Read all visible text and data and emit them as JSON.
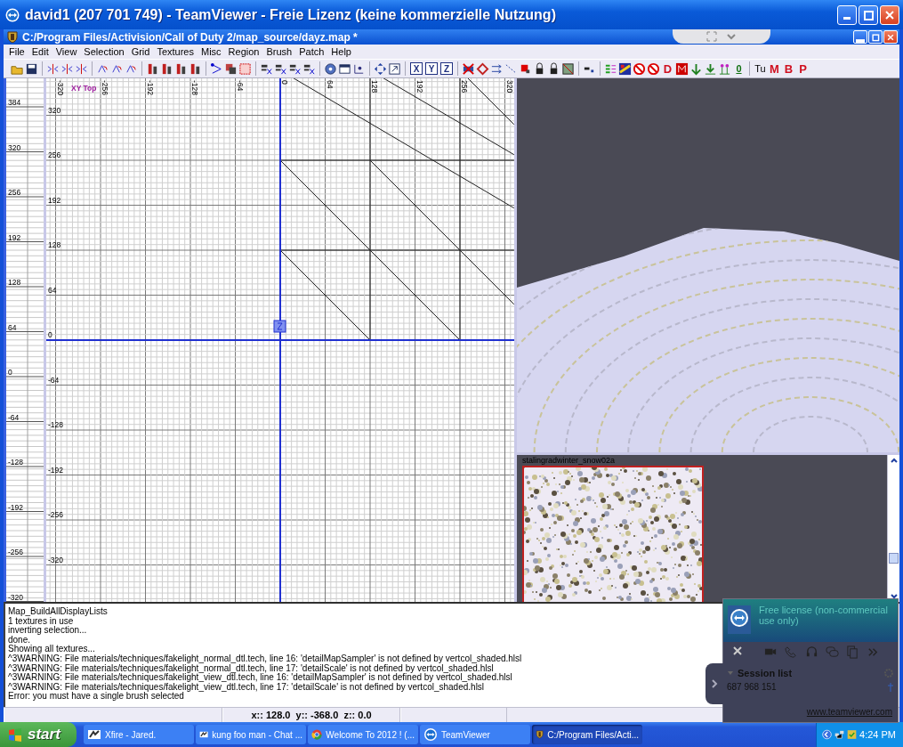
{
  "window": {
    "title": "david1 (207 701 749) - TeamViewer - Freie Lizenz (keine kommerzielle Nutzung)"
  },
  "app": {
    "title": "C:/Program Files/Activision/Call of Duty 2/map_source/dayz.map *"
  },
  "menu": [
    "File",
    "Edit",
    "View",
    "Selection",
    "Grid",
    "Textures",
    "Misc",
    "Region",
    "Brush",
    "Patch",
    "Help"
  ],
  "toolbar": {
    "letters": [
      {
        "label": "X",
        "kind": "boxed"
      },
      {
        "label": "Y",
        "kind": "boxed"
      },
      {
        "label": "Z",
        "kind": "boxed"
      },
      {
        "label": "D",
        "kind": "bold"
      },
      {
        "label": "0",
        "kind": "underlined"
      },
      {
        "label": "Tu",
        "kind": "plain"
      },
      {
        "label": "M",
        "kind": "bold"
      },
      {
        "label": "B",
        "kind": "bold"
      },
      {
        "label": "P",
        "kind": "bold"
      }
    ]
  },
  "z_ruler": {
    "labels": [
      "384",
      "320",
      "256",
      "192",
      "128",
      "64",
      "0",
      "-64",
      "-128",
      "-192",
      "-256",
      "-320"
    ]
  },
  "grid": {
    "view_label": "XY Top",
    "x_labels": [
      "-320",
      "-256",
      "-192",
      "-128",
      "-64",
      "0",
      "64",
      "128",
      "192",
      "256",
      "320"
    ],
    "y_labels": [
      "320",
      "256",
      "192",
      "128",
      "64",
      "0",
      "-64",
      "-128",
      "-192",
      "-256",
      "-320"
    ]
  },
  "texture_browser": {
    "texture_name": "stalingradwinter_snow02a"
  },
  "console": [
    "Map_BuildAllDisplayLists",
    "1 textures in use",
    "inverting selection...",
    "done.",
    "Showing all textures...",
    "^3WARNING: File materials/techniques/fakelight_normal_dtl.tech, line 16: 'detailMapSampler' is not defined by vertcol_shaded.hlsl",
    "^3WARNING: File materials/techniques/fakelight_normal_dtl.tech, line 17: 'detailScale' is not defined by vertcol_shaded.hlsl",
    "^3WARNING: File materials/techniques/fakelight_view_dtl.tech, line 16: 'detailMapSampler' is not defined by vertcol_shaded.hlsl",
    "^3WARNING: File materials/techniques/fakelight_view_dtl.tech, line 17: 'detailScale' is not defined by vertcol_shaded.hlsl",
    "Error: you must have a single brush selected"
  ],
  "status_bar": {
    "coordinates": "x:: 128.0  y:: -368.0  z:: 0.0"
  },
  "taskbar": {
    "start": "start",
    "tasks": [
      {
        "label": "Xfire - Jared.",
        "kind": "chat",
        "selected": false
      },
      {
        "label": "kung foo man - Chat ...",
        "kind": "chat",
        "selected": false
      },
      {
        "label": "Welcome To 2012 ! (...",
        "kind": "browser",
        "selected": false
      },
      {
        "label": "TeamViewer",
        "kind": "remote",
        "selected": false
      },
      {
        "label": "C:/Program Files/Acti...",
        "kind": "editor",
        "selected": true
      }
    ],
    "clock": "4:24 PM"
  },
  "teamviewer_panel": {
    "license": "Free license (non-commercial use only)",
    "session_list": "Session list",
    "session_id": "687 968 151",
    "link": "www.teamviewer.com"
  }
}
